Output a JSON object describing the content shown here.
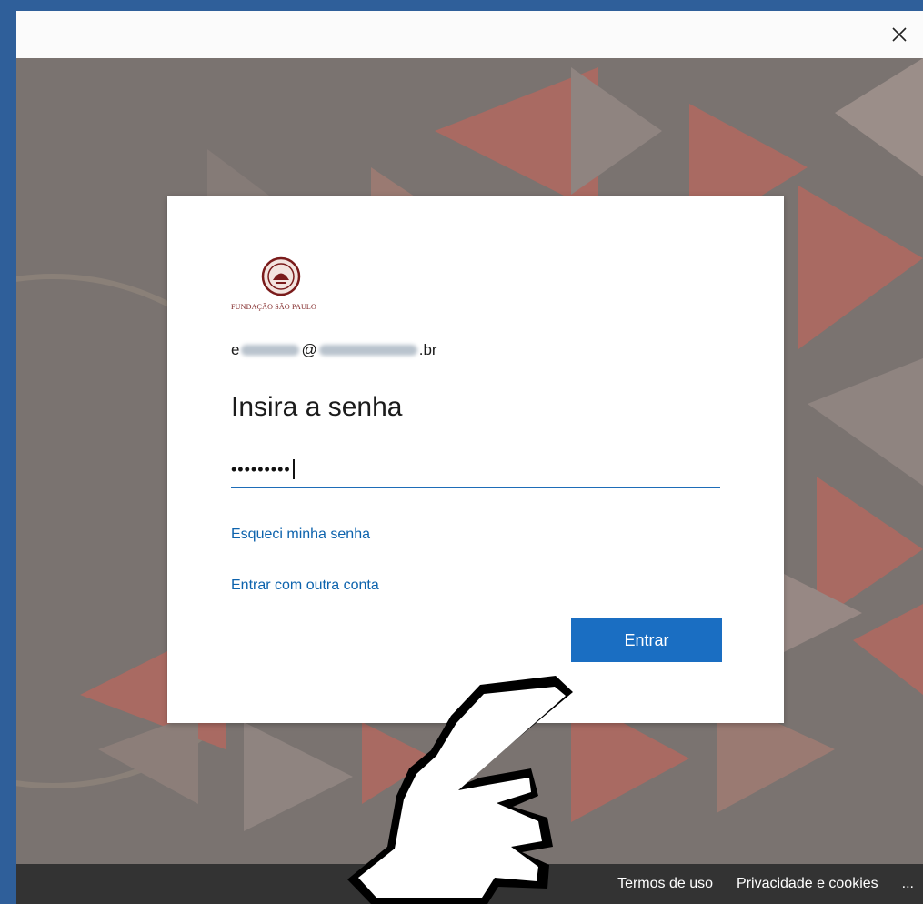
{
  "dialog": {
    "logo_text": "FUNDAÇÃO SÃO PAULO",
    "email_prefix": "e",
    "email_at": "@",
    "email_suffix": ".br",
    "title": "Insira a senha",
    "password_value": "•••••••••",
    "forgot_link": "Esqueci minha senha",
    "other_account_link": "Entrar com outra conta",
    "submit_label": "Entrar"
  },
  "footer": {
    "terms": "Termos de uso",
    "privacy": "Privacidade e cookies",
    "more": "..."
  },
  "colors": {
    "accent": "#1a6ec2",
    "link": "#0d63ad",
    "brand": "#7a1b1b"
  },
  "icons": [
    "close-icon",
    "seal-logo-icon",
    "pointing-hand-cursor-icon"
  ]
}
